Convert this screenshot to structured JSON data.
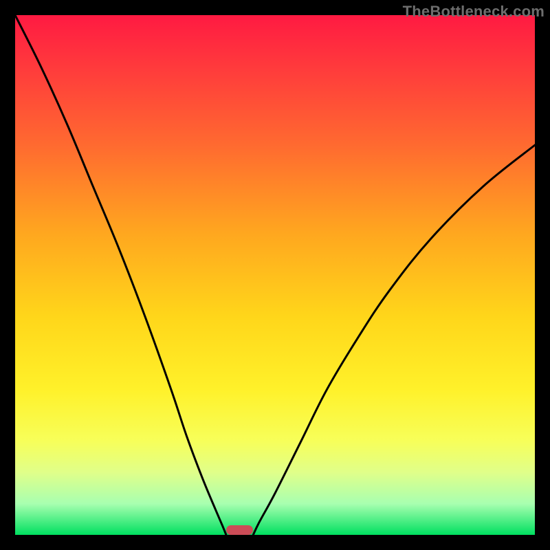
{
  "watermark": "TheBottleneck.com",
  "colors": {
    "background": "#000000",
    "gradient_top": "#ff1a42",
    "gradient_mid": "#fff12a",
    "gradient_bottom": "#00e060",
    "curve": "#000000",
    "marker": "#cc4c57",
    "watermark_text": "#6d6d6d"
  },
  "chart_data": {
    "type": "line",
    "title": "",
    "xlabel": "",
    "ylabel": "",
    "xlim": [
      0,
      100
    ],
    "ylim": [
      0,
      100
    ],
    "grid": false,
    "legend": false,
    "series": [
      {
        "name": "left-curve",
        "x": [
          0,
          5,
          10,
          15,
          20,
          25,
          30,
          33,
          36,
          38.5,
          40,
          40.6
        ],
        "y": [
          100,
          90,
          79,
          67,
          55,
          42,
          28,
          19,
          11,
          5,
          1.5,
          0
        ]
      },
      {
        "name": "right-curve",
        "x": [
          45.8,
          47,
          50,
          55,
          60,
          66,
          72,
          80,
          90,
          100
        ],
        "y": [
          0,
          2.5,
          8,
          18,
          28,
          38,
          47,
          57,
          67,
          75
        ]
      }
    ],
    "marker": {
      "x_center": 43.2,
      "width_pct": 5.2,
      "y": 0
    },
    "background_gradient": {
      "direction": "vertical",
      "stops": [
        {
          "pos": 0.0,
          "color": "#ff1a42"
        },
        {
          "pos": 0.25,
          "color": "#ff6a30"
        },
        {
          "pos": 0.58,
          "color": "#ffd61a"
        },
        {
          "pos": 0.82,
          "color": "#f7ff5a"
        },
        {
          "pos": 1.0,
          "color": "#00e060"
        }
      ]
    }
  }
}
